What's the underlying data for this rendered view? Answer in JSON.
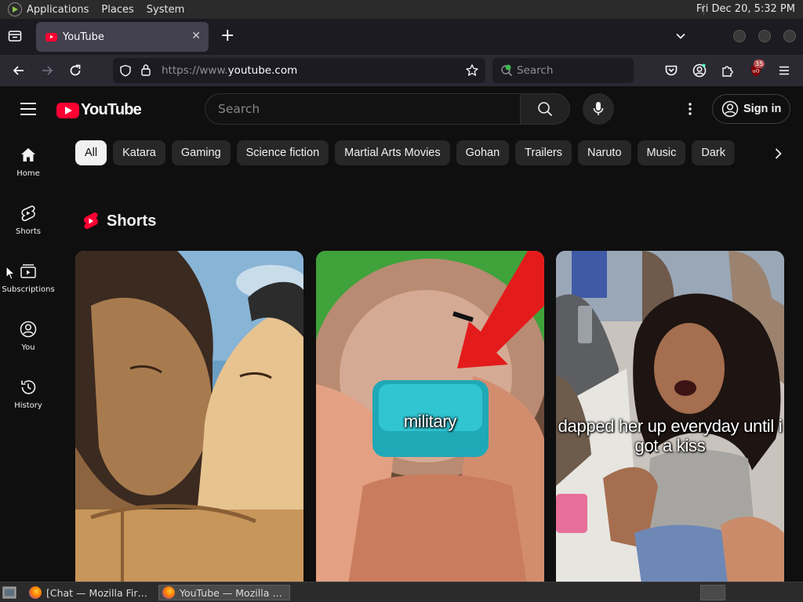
{
  "os_panel": {
    "menus": [
      "Applications",
      "Places",
      "System"
    ],
    "clock": "Fri Dec 20,  5:32 PM"
  },
  "browser": {
    "tab": {
      "title": "YouTube",
      "close": "✕"
    },
    "new_tab": "+",
    "url": {
      "scheme": "https://www.",
      "host": "youtube.com"
    },
    "search_placeholder": "Search",
    "extensions_badge": "35"
  },
  "youtube": {
    "logo_text": "YouTube",
    "search_placeholder": "Search",
    "sign_in": "Sign in",
    "sidebar": [
      {
        "label": "Home",
        "icon": "home-icon"
      },
      {
        "label": "Shorts",
        "icon": "shorts-icon"
      },
      {
        "label": "Subscriptions",
        "icon": "subscriptions-icon"
      },
      {
        "label": "You",
        "icon": "you-icon"
      },
      {
        "label": "History",
        "icon": "history-icon"
      }
    ],
    "chips": [
      "All",
      "Katara",
      "Gaming",
      "Science fiction",
      "Martial Arts Movies",
      "Gohan",
      "Trailers",
      "Naruto",
      "Music",
      "Dark"
    ],
    "active_chip": "All",
    "shorts_title": "Shorts",
    "shorts": [
      {
        "caption": ""
      },
      {
        "caption": "military"
      },
      {
        "caption": "dapped her up everyday until i got a kiss"
      }
    ]
  },
  "taskbar": {
    "tasks": [
      {
        "label": "[Chat — Mozilla Fir…",
        "active": false
      },
      {
        "label": "YouTube — Mozilla …",
        "active": true
      }
    ]
  }
}
